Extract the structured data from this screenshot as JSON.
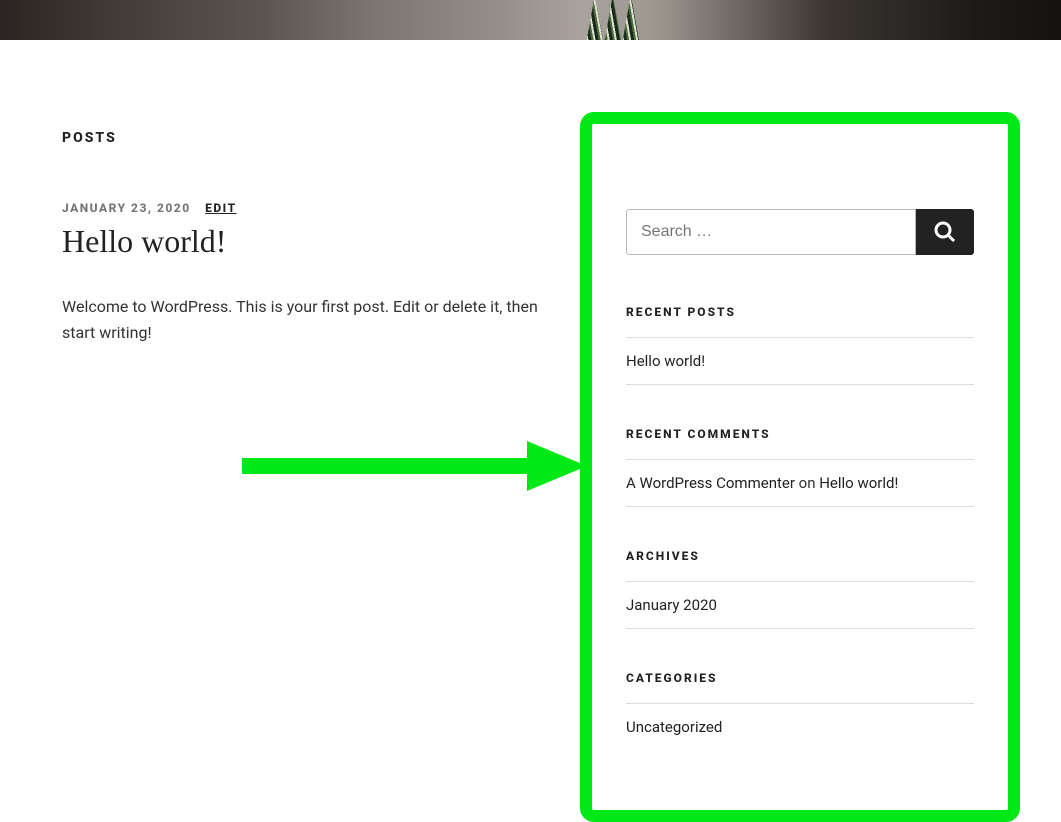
{
  "hero": {},
  "main": {
    "heading": "POSTS",
    "post": {
      "date": "JANUARY 23, 2020",
      "edit": "EDIT",
      "title": "Hello world!",
      "excerpt": "Welcome to WordPress. This is your first post. Edit or delete it, then start writing!"
    }
  },
  "sidebar": {
    "search": {
      "placeholder": "Search …"
    },
    "recent_posts": {
      "title": "RECENT POSTS",
      "items": [
        "Hello world!"
      ]
    },
    "recent_comments": {
      "title": "RECENT COMMENTS",
      "items": [
        {
          "author": "A WordPress Commenter",
          "on": "on",
          "post": "Hello world!"
        }
      ]
    },
    "archives": {
      "title": "ARCHIVES",
      "items": [
        "January 2020"
      ]
    },
    "categories": {
      "title": "CATEGORIES",
      "items": [
        "Uncategorized"
      ]
    }
  },
  "colors": {
    "highlight": "#00e815"
  }
}
